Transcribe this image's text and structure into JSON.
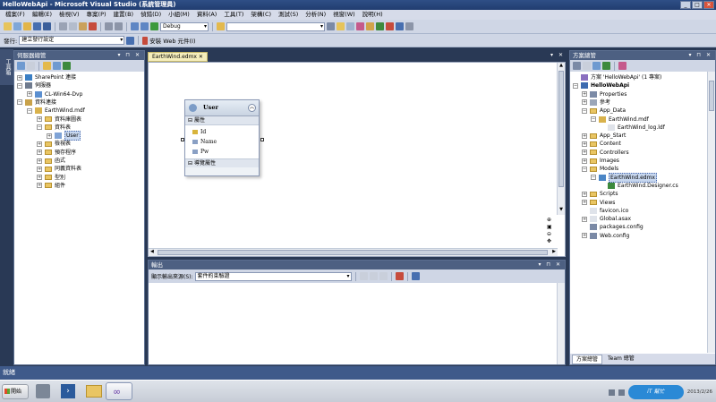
{
  "window": {
    "title": "HelloWebApi - Microsoft Visual Studio (系統管理員)",
    "controls": [
      "_",
      "□",
      "✕"
    ]
  },
  "menu": [
    "檔案(F)",
    "編輯(E)",
    "檢視(V)",
    "專案(P)",
    "建置(B)",
    "偵錯(D)",
    "小組(M)",
    "資料(A)",
    "工具(T)",
    "架構(C)",
    "測試(S)",
    "分析(N)",
    "視窗(W)",
    "說明(H)"
  ],
  "toolbar": {
    "config": "Debug",
    "search_value": ""
  },
  "toolbar2": {
    "publish_label": "發行:",
    "publish_value": "建立發行設定",
    "web_publish": "安裝 Web 元件(I)"
  },
  "side_tab": "工具箱",
  "server_explorer": {
    "title": "伺服器總管",
    "items": [
      {
        "label": "SharePoint 連接",
        "level": 0,
        "exp": "+",
        "icon": "sharepoint"
      },
      {
        "label": "伺服器",
        "level": 0,
        "exp": "-",
        "icon": "servers"
      },
      {
        "label": "CL-Win64-Dvp",
        "level": 1,
        "exp": "+",
        "icon": "computer"
      },
      {
        "label": "資料連接",
        "level": 0,
        "exp": "-",
        "icon": "dataconn"
      },
      {
        "label": "EarthWind.mdf",
        "level": 1,
        "exp": "-",
        "icon": "db"
      },
      {
        "label": "資料庫圖表",
        "level": 2,
        "exp": "+",
        "icon": "folder"
      },
      {
        "label": "資料表",
        "level": 2,
        "exp": "-",
        "icon": "folder"
      },
      {
        "label": "User",
        "level": 3,
        "exp": "+",
        "icon": "table",
        "selected": true
      },
      {
        "label": "檢視表",
        "level": 2,
        "exp": "+",
        "icon": "folder"
      },
      {
        "label": "預存程序",
        "level": 2,
        "exp": "+",
        "icon": "folder"
      },
      {
        "label": "函式",
        "level": 2,
        "exp": "+",
        "icon": "folder"
      },
      {
        "label": "同義資料表",
        "level": 2,
        "exp": "+",
        "icon": "folder"
      },
      {
        "label": "型別",
        "level": 2,
        "exp": "+",
        "icon": "folder"
      },
      {
        "label": "組件",
        "level": 2,
        "exp": "+",
        "icon": "folder"
      }
    ]
  },
  "editor": {
    "tab": "EarthWind.edmx",
    "entity": {
      "name": "User",
      "props_header": "屬性",
      "props": [
        "Id",
        "Name",
        "Pw"
      ],
      "nav_header": "導覽屬性"
    }
  },
  "output": {
    "title": "輸出",
    "source_label": "顯示輸出來源(S):",
    "source_value": "套件約束驗證"
  },
  "solution_explorer": {
    "title": "方案總管",
    "items": [
      {
        "label": "方案 'HelloWebApi' (1 專案)",
        "level": 0,
        "exp": "",
        "icon": "solution"
      },
      {
        "label": "HelloWebApi",
        "level": 0,
        "exp": "-",
        "icon": "project",
        "bold": true
      },
      {
        "label": "Properties",
        "level": 1,
        "exp": "+",
        "icon": "props"
      },
      {
        "label": "參考",
        "level": 1,
        "exp": "+",
        "icon": "refs"
      },
      {
        "label": "App_Data",
        "level": 1,
        "exp": "-",
        "icon": "folder"
      },
      {
        "label": "EarthWind.mdf",
        "level": 2,
        "exp": "-",
        "icon": "db"
      },
      {
        "label": "EarthWind_log.ldf",
        "level": 3,
        "exp": "",
        "icon": "file"
      },
      {
        "label": "App_Start",
        "level": 1,
        "exp": "+",
        "icon": "folder"
      },
      {
        "label": "Content",
        "level": 1,
        "exp": "+",
        "icon": "folder"
      },
      {
        "label": "Controllers",
        "level": 1,
        "exp": "+",
        "icon": "folder"
      },
      {
        "label": "Images",
        "level": 1,
        "exp": "+",
        "icon": "folder"
      },
      {
        "label": "Models",
        "level": 1,
        "exp": "-",
        "icon": "folder"
      },
      {
        "label": "EarthWind.edmx",
        "level": 2,
        "exp": "-",
        "icon": "edmx",
        "selected": true
      },
      {
        "label": "EarthWind.Designer.cs",
        "level": 3,
        "exp": "",
        "icon": "cs"
      },
      {
        "label": "Scripts",
        "level": 1,
        "exp": "+",
        "icon": "folder"
      },
      {
        "label": "Views",
        "level": 1,
        "exp": "+",
        "icon": "folder"
      },
      {
        "label": "favicon.ico",
        "level": 1,
        "exp": "",
        "icon": "file"
      },
      {
        "label": "Global.asax",
        "level": 1,
        "exp": "+",
        "icon": "file"
      },
      {
        "label": "packages.config",
        "level": 1,
        "exp": "",
        "icon": "config"
      },
      {
        "label": "Web.config",
        "level": 1,
        "exp": "+",
        "icon": "config"
      }
    ],
    "tabs": [
      "方案總管",
      "Team 總管"
    ]
  },
  "status": "就緒",
  "taskbar": {
    "start": "開始",
    "tray_date": "2013/2/26"
  }
}
